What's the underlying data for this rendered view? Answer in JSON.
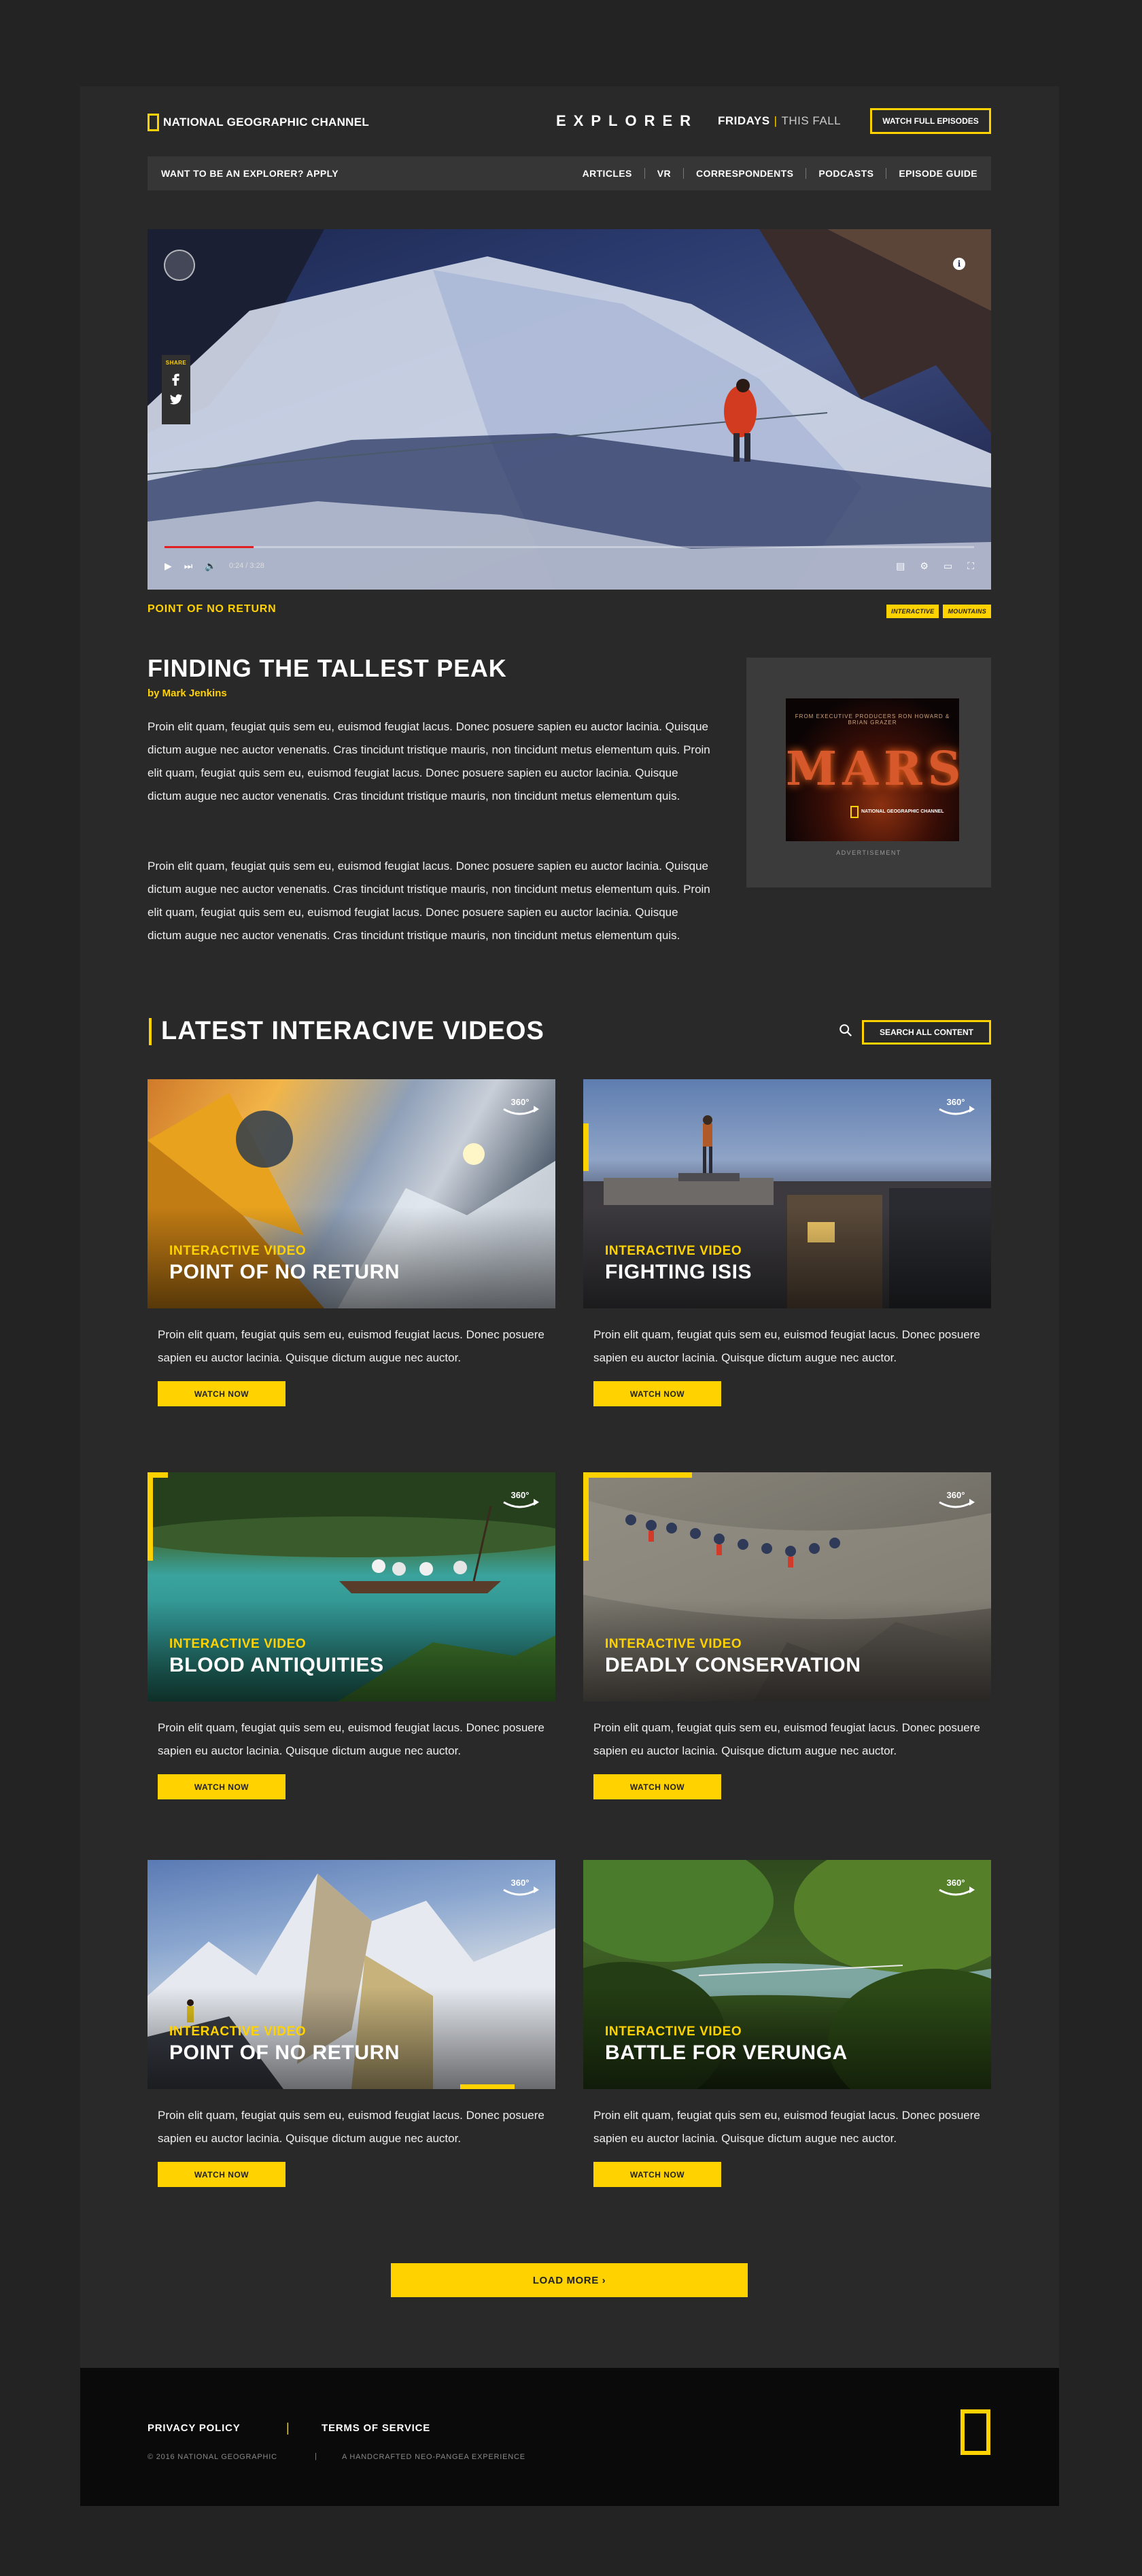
{
  "header": {
    "brand": "NATIONAL GEOGRAPHIC CHANNEL",
    "show_logo": "EXPLORER",
    "schedule_day": "FRIDAYS",
    "schedule_separator": "|",
    "schedule_when": "THIS FALL",
    "watch_button": "WATCH FULL EPISODES"
  },
  "nav": {
    "apply": "WANT TO BE AN EXPLORER? APPLY",
    "links": [
      "ARTICLES",
      "VR",
      "CORRESPONDENTS",
      "PODCASTS",
      "EPISODE GUIDE"
    ]
  },
  "share": {
    "label": "SHARE",
    "icons": [
      "facebook-icon",
      "twitter-icon"
    ]
  },
  "video": {
    "time": "0:24 / 3:28",
    "progress": 0.11
  },
  "article": {
    "kicker": "POINT OF NO RETURN",
    "tags": [
      "INTERACTIVE",
      "MOUNTAINS"
    ],
    "title": "FINDING THE TALLEST PEAK",
    "byline": "by Mark Jenkins",
    "paragraphs": [
      "Proin elit quam, feugiat quis sem eu, euismod feugiat lacus. Donec posuere sapien eu auctor lacinia. Quisque dictum augue nec auctor venenatis. Cras tincidunt tristique mauris, non tincidunt metus elementum quis. Proin elit quam, feugiat quis sem eu, euismod feugiat lacus. Donec posuere sapien eu auctor lacinia. Quisque dictum augue nec auctor venenatis. Cras tincidunt tristique mauris, non tincidunt metus elementum quis.",
      "Proin elit quam, feugiat quis sem eu, euismod feugiat lacus. Donec posuere sapien eu auctor lacinia. Quisque dictum augue nec auctor venenatis. Cras tincidunt tristique mauris, non tincidunt metus elementum quis. Proin elit quam, feugiat quis sem eu, euismod feugiat lacus. Donec posuere sapien eu auctor lacinia. Quisque dictum augue nec auctor venenatis. Cras tincidunt tristique mauris, non tincidunt metus elementum quis."
    ]
  },
  "ad": {
    "tagline": "FROM EXECUTIVE PRODUCERS RON HOWARD & BRIAN GRAZER",
    "title": "MARS",
    "logo_text": "NATIONAL GEOGRAPHIC CHANNEL",
    "label": "ADVERTISEMENT"
  },
  "latest": {
    "title": "LATEST INTERACIVE VIDEOS",
    "search_all": "SEARCH ALL CONTENT",
    "cards": [
      {
        "kicker": "INTERACTIVE VIDEO",
        "title": "POINT OF NO RETURN",
        "desc": "Proin elit quam, feugiat quis sem eu, euismod feugiat lacus. Donec posuere sapien eu auctor lacinia. Quisque dictum augue nec auctor.",
        "button": "WATCH NOW"
      },
      {
        "kicker": "INTERACTIVE VIDEO",
        "title": "FIGHTING ISIS",
        "desc": "Proin elit quam, feugiat quis sem eu, euismod feugiat lacus. Donec posuere sapien eu auctor lacinia. Quisque dictum augue nec auctor.",
        "button": "WATCH NOW"
      },
      {
        "kicker": "INTERACTIVE VIDEO",
        "title": "BLOOD ANTIQUITIES",
        "desc": "Proin elit quam, feugiat quis sem eu, euismod feugiat lacus. Donec posuere sapien eu auctor lacinia. Quisque dictum augue nec auctor.",
        "button": "WATCH NOW"
      },
      {
        "kicker": "INTERACTIVE VIDEO",
        "title": "DEADLY CONSERVATION",
        "desc": "Proin elit quam, feugiat quis sem eu, euismod feugiat lacus. Donec posuere sapien eu auctor lacinia. Quisque dictum augue nec auctor.",
        "button": "WATCH NOW"
      },
      {
        "kicker": "INTERACTIVE VIDEO",
        "title": "POINT OF NO RETURN",
        "desc": "Proin elit quam, feugiat quis sem eu, euismod feugiat lacus. Donec posuere sapien eu auctor lacinia. Quisque dictum augue nec auctor.",
        "button": "WATCH NOW"
      },
      {
        "kicker": "INTERACTIVE VIDEO",
        "title": "BATTLE FOR VERUNGA",
        "desc": "Proin elit quam, feugiat quis sem eu, euismod feugiat lacus. Donec posuere sapien eu auctor lacinia. Quisque dictum augue nec auctor.",
        "button": "WATCH NOW"
      }
    ],
    "badge_text": "360°",
    "load_more": "LOAD MORE ›"
  },
  "footer": {
    "privacy": "PRIVACY POLICY",
    "separator": "|",
    "terms": "TERMS OF SERVICE",
    "copyright": "© 2016 NATIONAL GEOGRAPHIC",
    "credit": "A HANDCRAFTED NEO-PANGEA EXPERIENCE"
  },
  "colors": {
    "accent": "#ffd200",
    "page": "#292929",
    "background": "#232323",
    "footer": "#0a0a0a"
  }
}
